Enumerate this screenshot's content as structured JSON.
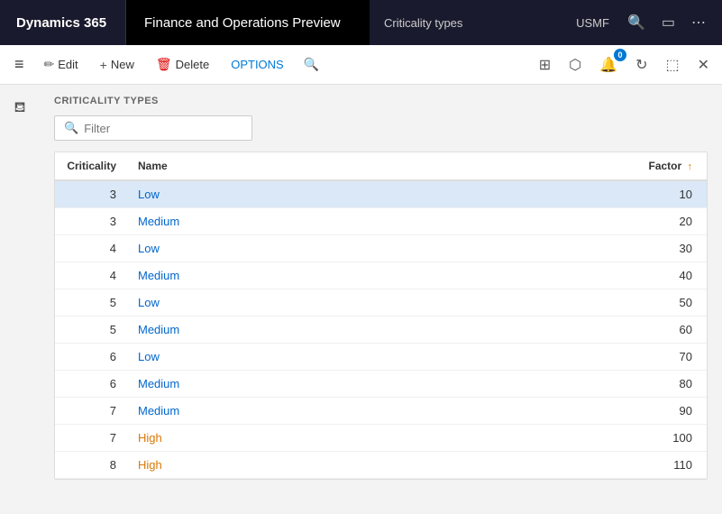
{
  "topbar": {
    "dynamics_label": "Dynamics 365",
    "app_title": "Finance and Operations Preview",
    "page_title": "Criticality types",
    "usmf_label": "USMF"
  },
  "toolbar": {
    "edit_label": "Edit",
    "new_label": "New",
    "delete_label": "Delete",
    "options_label": "OPTIONS",
    "notification_count": "0",
    "hamburger_icon": "≡"
  },
  "content": {
    "section_title": "CRITICALITY TYPES",
    "filter_placeholder": "Filter",
    "table": {
      "columns": [
        {
          "key": "criticality",
          "label": "Criticality"
        },
        {
          "key": "name",
          "label": "Name"
        },
        {
          "key": "factor",
          "label": "Factor ↑"
        }
      ],
      "rows": [
        {
          "criticality": "3",
          "name": "Low",
          "factor": "10",
          "selected": true,
          "type": "low"
        },
        {
          "criticality": "3",
          "name": "Medium",
          "factor": "20",
          "selected": false,
          "type": "medium"
        },
        {
          "criticality": "4",
          "name": "Low",
          "factor": "30",
          "selected": false,
          "type": "low"
        },
        {
          "criticality": "4",
          "name": "Medium",
          "factor": "40",
          "selected": false,
          "type": "medium"
        },
        {
          "criticality": "5",
          "name": "Low",
          "factor": "50",
          "selected": false,
          "type": "low"
        },
        {
          "criticality": "5",
          "name": "Medium",
          "factor": "60",
          "selected": false,
          "type": "medium"
        },
        {
          "criticality": "6",
          "name": "Low",
          "factor": "70",
          "selected": false,
          "type": "low"
        },
        {
          "criticality": "6",
          "name": "Medium",
          "factor": "80",
          "selected": false,
          "type": "medium"
        },
        {
          "criticality": "7",
          "name": "Medium",
          "factor": "90",
          "selected": false,
          "type": "medium"
        },
        {
          "criticality": "7",
          "name": "High",
          "factor": "100",
          "selected": false,
          "type": "high"
        },
        {
          "criticality": "8",
          "name": "High",
          "factor": "110",
          "selected": false,
          "type": "high"
        }
      ]
    }
  }
}
